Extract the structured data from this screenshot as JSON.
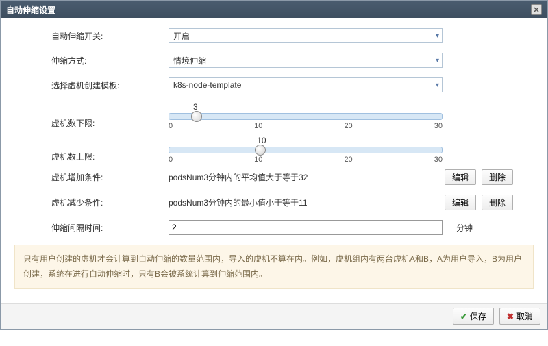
{
  "dialog": {
    "title": "自动伸缩设置"
  },
  "form": {
    "switch": {
      "label": "自动伸缩开关:",
      "value": "开启"
    },
    "mode": {
      "label": "伸缩方式:",
      "value": "情境伸缩"
    },
    "template": {
      "label": "选择虚机创建模板:",
      "value": "k8s-node-template"
    },
    "min": {
      "label": "虚机数下限:",
      "value": "3",
      "ticks": [
        "0",
        "10",
        "20",
        "30"
      ],
      "percent": 10
    },
    "max": {
      "label": "虚机数上限:",
      "value": "10",
      "ticks": [
        "0",
        "10",
        "20",
        "30"
      ],
      "percent": 33.3
    },
    "rule_add": {
      "label": "虚机增加条件:",
      "text": "podsNum3分钟内的平均值大于等于32",
      "edit": "编辑",
      "delete": "删除"
    },
    "rule_del": {
      "label": "虚机减少条件:",
      "text": "podsNum3分钟内的最小值小于等于11",
      "edit": "编辑",
      "delete": "删除"
    },
    "interval": {
      "label": "伸缩间隔时间:",
      "value": "2",
      "unit": "分钟"
    }
  },
  "info": "只有用户创建的虚机才会计算到自动伸缩的数量范围内，导入的虚机不算在内。例如，虚机组内有两台虚机A和B，A为用户导入，B为用户创建，系统在进行自动伸缩时，只有B会被系统计算到伸缩范围内。",
  "footer": {
    "save": "保存",
    "cancel": "取消"
  }
}
